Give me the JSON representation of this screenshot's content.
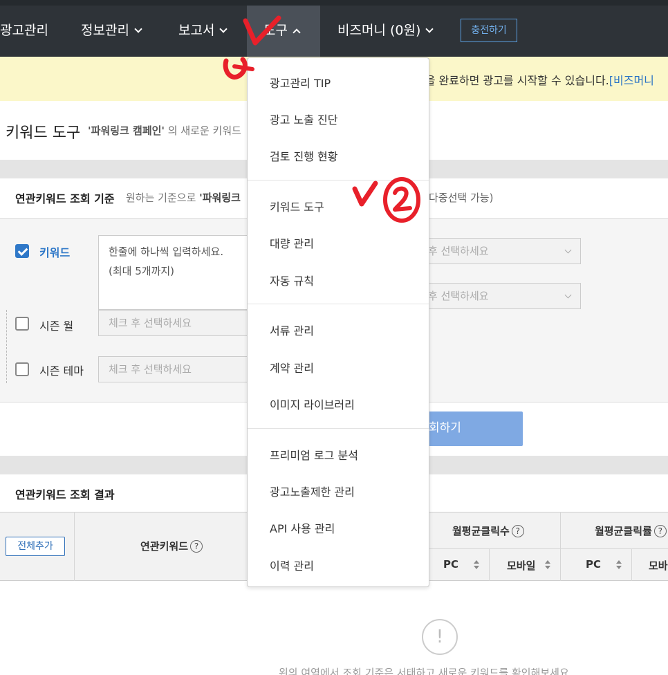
{
  "nav": {
    "items": [
      "광고관리",
      "정보관리",
      "보고서",
      "도구",
      "비즈머니 (0원)"
    ],
    "charge_label": "충전하기"
  },
  "notice": {
    "text": "전을 완료하면 광고를 시작할 수 있습니다.",
    "link": "[비즈머니"
  },
  "header": {
    "title": "키워드 도구",
    "campaign": "'파워링크 캠페인'",
    "desc": " 의 새로운 키워드"
  },
  "criteria": {
    "title": "연관키워드 조회 기준",
    "desc": "원하는 기준으로 ",
    "desc_bold": "'파워링크",
    "multi": "다중선택 가능)",
    "keyword_label": "키워드",
    "keyword_placeholder": "한줄에 하나씩 입력하세요.\n(최대 5개까지)",
    "season_month_label": "시즌 월",
    "season_theme_label": "시즌 테마",
    "select_placeholder": "체크 후 선택하세요",
    "select_placeholder_partial": "후 선택하세요",
    "search_button": "회하기"
  },
  "results": {
    "title": "연관키워드 조회 결과",
    "add_all": "전체추가",
    "col_keyword": "연관키워드",
    "col_clicks": "월평균클릭수",
    "col_ctr": "월평균클릭률",
    "sub_pc": "PC",
    "sub_mobile": "모바일",
    "sub_mobile_partial": "모바",
    "help_glyph": "?",
    "empty_icon": "!",
    "empty_message": "왼의 여역에서 조회 기준은 서태하고 새로운 키워드를 확인해보세요"
  },
  "dropdown": {
    "groups": [
      [
        "광고관리 TIP",
        "광고 노출 진단",
        "검토 진행 현황"
      ],
      [
        "키워드 도구",
        "대량 관리",
        "자동 규칙"
      ],
      [
        "서류 관리",
        "계약 관리",
        "이미지 라이브러리"
      ],
      [
        "프리미엄 로그 분석",
        "광고노출제한 관리",
        "API 사용 관리",
        "이력 관리"
      ]
    ]
  },
  "colors": {
    "nav_bg": "#2e3338",
    "accent": "#2f78c8",
    "notice_bg": "#fbf7c9",
    "annotation": "#e8202a"
  },
  "icons": [
    "chevron-down-icon",
    "chevron-up-icon",
    "checkbox-checked-icon",
    "checkbox-icon",
    "help-icon",
    "sort-icon",
    "exclamation-icon"
  ]
}
